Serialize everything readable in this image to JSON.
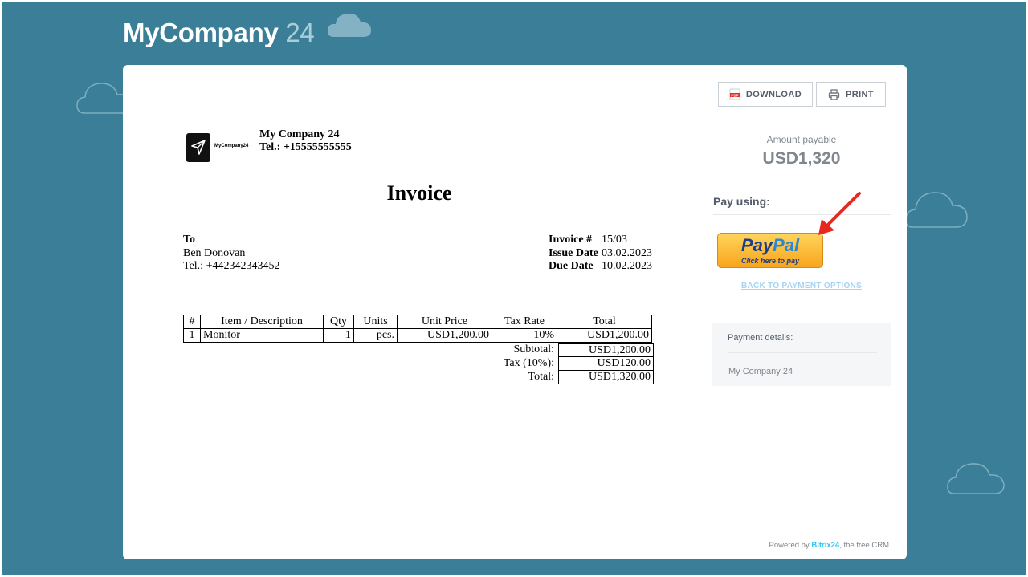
{
  "header": {
    "brand_name": "MyCompany",
    "brand_num": "24"
  },
  "seller": {
    "logo_text": "MyCompany24",
    "name": "My Company 24",
    "tel": "Tel.: +15555555555"
  },
  "invoice": {
    "title": "Invoice",
    "to_label": "To",
    "buyer_name": "Ben Donovan",
    "buyer_tel": "Tel.: +442342343452",
    "meta": [
      {
        "label": "Invoice #",
        "value": "15/03"
      },
      {
        "label": "Issue Date",
        "value": "03.02.2023"
      },
      {
        "label": "Due Date",
        "value": "10.02.2023"
      }
    ],
    "columns": [
      "#",
      "Item / Description",
      "Qty",
      "Units",
      "Unit Price",
      "Tax Rate",
      "Total"
    ],
    "rows": [
      {
        "num": "1",
        "item": "Monitor",
        "qty": "1",
        "units": "pcs.",
        "unit_price": "USD1,200.00",
        "tax_rate": "10%",
        "total": "USD1,200.00"
      }
    ],
    "totals": [
      {
        "label": "Subtotal:",
        "value": "USD1,200.00"
      },
      {
        "label": "Tax (10%):",
        "value": "USD120.00"
      },
      {
        "label": "Total:",
        "value": "USD1,320.00"
      }
    ]
  },
  "actions": {
    "download_label": "DOWNLOAD",
    "download_icon": "pdf-icon",
    "print_label": "PRINT",
    "print_icon": "printer-icon"
  },
  "payment": {
    "amount_label": "Amount payable",
    "amount_value": "USD1,320",
    "pay_using_label": "Pay using:",
    "paypal_logo_pay": "Pay",
    "paypal_logo_pal": "Pal",
    "paypal_sub": "Click here to pay",
    "back_link": "BACK TO PAYMENT OPTIONS",
    "details_label": "Payment details:",
    "details_value": "My Company 24"
  },
  "footer": {
    "powered_prefix": "Powered by",
    "powered_brand": "Bitrix24",
    "powered_suffix": ", the free CRM"
  },
  "colors": {
    "background": "#3a7f97",
    "accent_arrow": "#e8281f",
    "paypal_blue": "#1b3e8f"
  }
}
